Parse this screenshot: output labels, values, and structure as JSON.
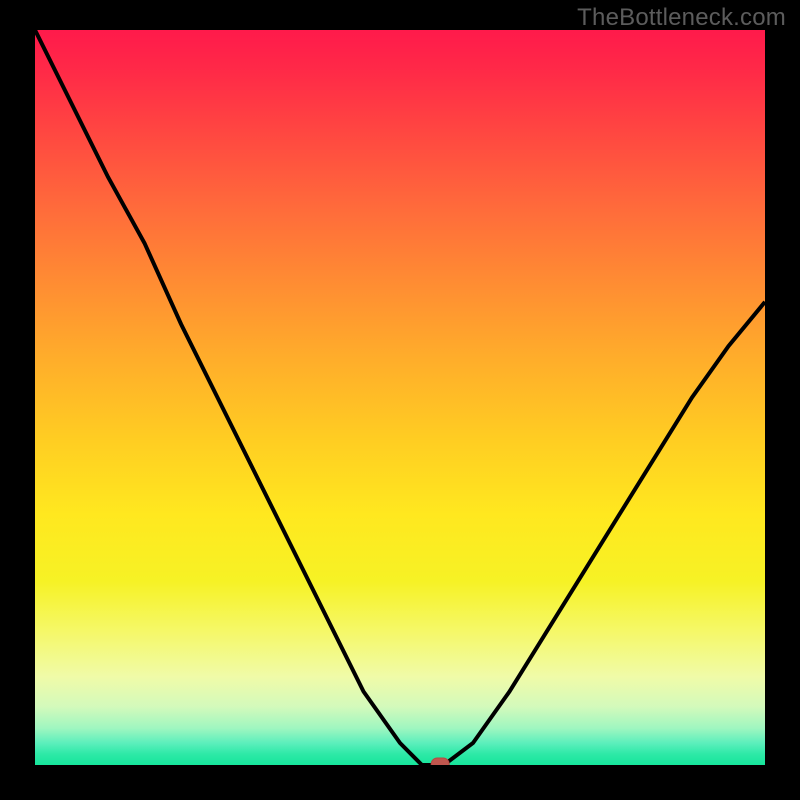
{
  "watermark": "TheBottleneck.com",
  "chart_data": {
    "type": "line",
    "title": "",
    "xlabel": "",
    "ylabel": "",
    "xlim": [
      0,
      100
    ],
    "ylim": [
      0,
      100
    ],
    "grid": false,
    "legend": false,
    "series": [
      {
        "name": "bottleneck-curve",
        "x": [
          0,
          5,
          10,
          15,
          20,
          25,
          30,
          35,
          40,
          45,
          50,
          53,
          56,
          60,
          65,
          70,
          75,
          80,
          85,
          90,
          95,
          100
        ],
        "y": [
          100,
          90,
          80,
          71,
          60,
          50,
          40,
          30,
          20,
          10,
          3,
          0,
          0,
          3,
          10,
          18,
          26,
          34,
          42,
          50,
          57,
          63
        ]
      }
    ],
    "flat_min_range_x": [
      53,
      56
    ],
    "marker": {
      "x": 55.5,
      "y": 0,
      "shape": "pill"
    },
    "background_gradient": {
      "direction": "vertical",
      "stops": [
        {
          "pos": 0.0,
          "color": "#ff1a4b"
        },
        {
          "pos": 0.14,
          "color": "#ff4741"
        },
        {
          "pos": 0.34,
          "color": "#ff8b33"
        },
        {
          "pos": 0.56,
          "color": "#ffce22"
        },
        {
          "pos": 0.75,
          "color": "#f6f225"
        },
        {
          "pos": 0.92,
          "color": "#d4fabb"
        },
        {
          "pos": 1.0,
          "color": "#16e59c"
        }
      ]
    }
  }
}
